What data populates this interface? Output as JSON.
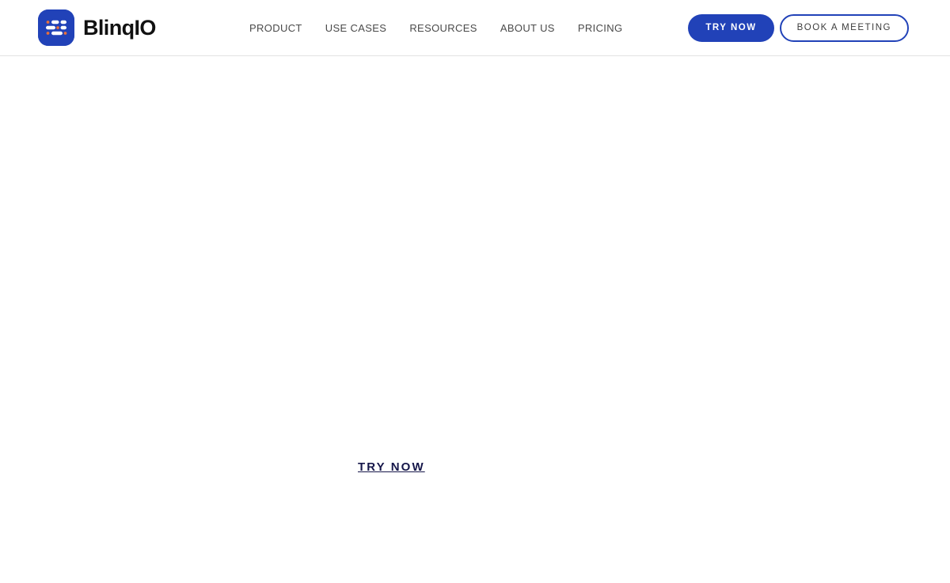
{
  "header": {
    "brand": {
      "logo_icon": "blinqio-logo-icon",
      "name": "BlinqIO",
      "logo_bg_color": "#2142b8",
      "logo_bar_color": "#ffffff",
      "logo_dot_color": "#e8703a"
    },
    "nav": {
      "items": [
        {
          "label": "PRODUCT"
        },
        {
          "label": "USE CASES"
        },
        {
          "label": "RESOURCES"
        },
        {
          "label": "ABOUT US"
        },
        {
          "label": "PRICING"
        }
      ]
    },
    "actions": {
      "try_now_label": "TRY NOW",
      "book_meeting_label": "BOOK A MEETING",
      "primary_color": "#2142b8",
      "outline_border_color": "#2142b8"
    }
  },
  "main": {
    "cta_text": "TRY NOW",
    "cta_text_color": "#16174a"
  }
}
